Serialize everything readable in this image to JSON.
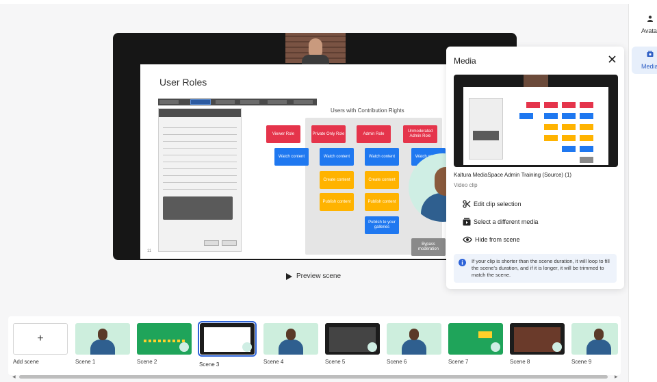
{
  "rail": {
    "avatars_label": "Avatar",
    "media_label": "Media"
  },
  "slide": {
    "title": "User Roles",
    "chart_heading": "Users with Contribution Rights",
    "page_number": "11",
    "roles": [
      "Viewer Role",
      "Private Only Role",
      "Admin Role",
      "Unmoderated Admin Role"
    ],
    "watch_label": "Watch content",
    "yellow_1": "Create content",
    "yellow_2": "Publish content",
    "blue_2": "Publish to your galleries",
    "gray_1": "Bypass moderation"
  },
  "preview_label": "Preview scene",
  "media_panel": {
    "title": "Media",
    "clip_title": "Kaltura MediaSpace Admin Training (Source) (1)",
    "clip_type": "Video clip",
    "actions": {
      "edit": "Edit clip selection",
      "select": "Select a different media",
      "hide": "Hide from scene"
    },
    "info_text": "If your clip is shorter than the scene duration, it will loop to fill the scene's duration, and if it is longer, it will be trimmed to match the scene."
  },
  "filmstrip": {
    "add_label": "Add scene",
    "add_symbol": "+",
    "scenes": [
      "Scene 1",
      "Scene 2",
      "Scene 3",
      "Scene 4",
      "Scene 5",
      "Scene 6",
      "Scene 7",
      "Scene 8",
      "Scene 9"
    ],
    "selected_scene": "Scene 3"
  },
  "colors": {
    "accent": "#2d63d8",
    "role_red": "#e5344b",
    "action_blue": "#1f78f0",
    "action_yellow": "#ffb300"
  }
}
